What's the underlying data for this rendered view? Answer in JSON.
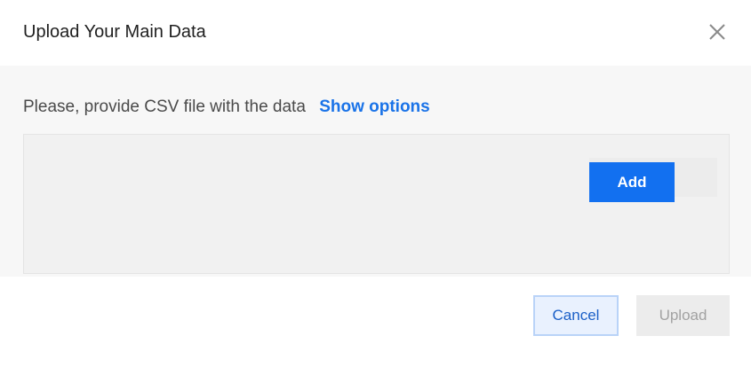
{
  "dialog": {
    "title": "Upload Your Main Data",
    "close_icon": "close-icon"
  },
  "body": {
    "prompt_text": "Please, provide CSV file with the data",
    "show_options_label": "Show options",
    "add_button_label": "Add"
  },
  "footer": {
    "cancel_label": "Cancel",
    "upload_label": "Upload",
    "upload_disabled": true
  },
  "colors": {
    "accent": "#1270f0",
    "link": "#1a73e8",
    "body_background": "#f7f7f7",
    "dropzone_background": "#f1f1f1",
    "disabled_button": "#ececec"
  }
}
